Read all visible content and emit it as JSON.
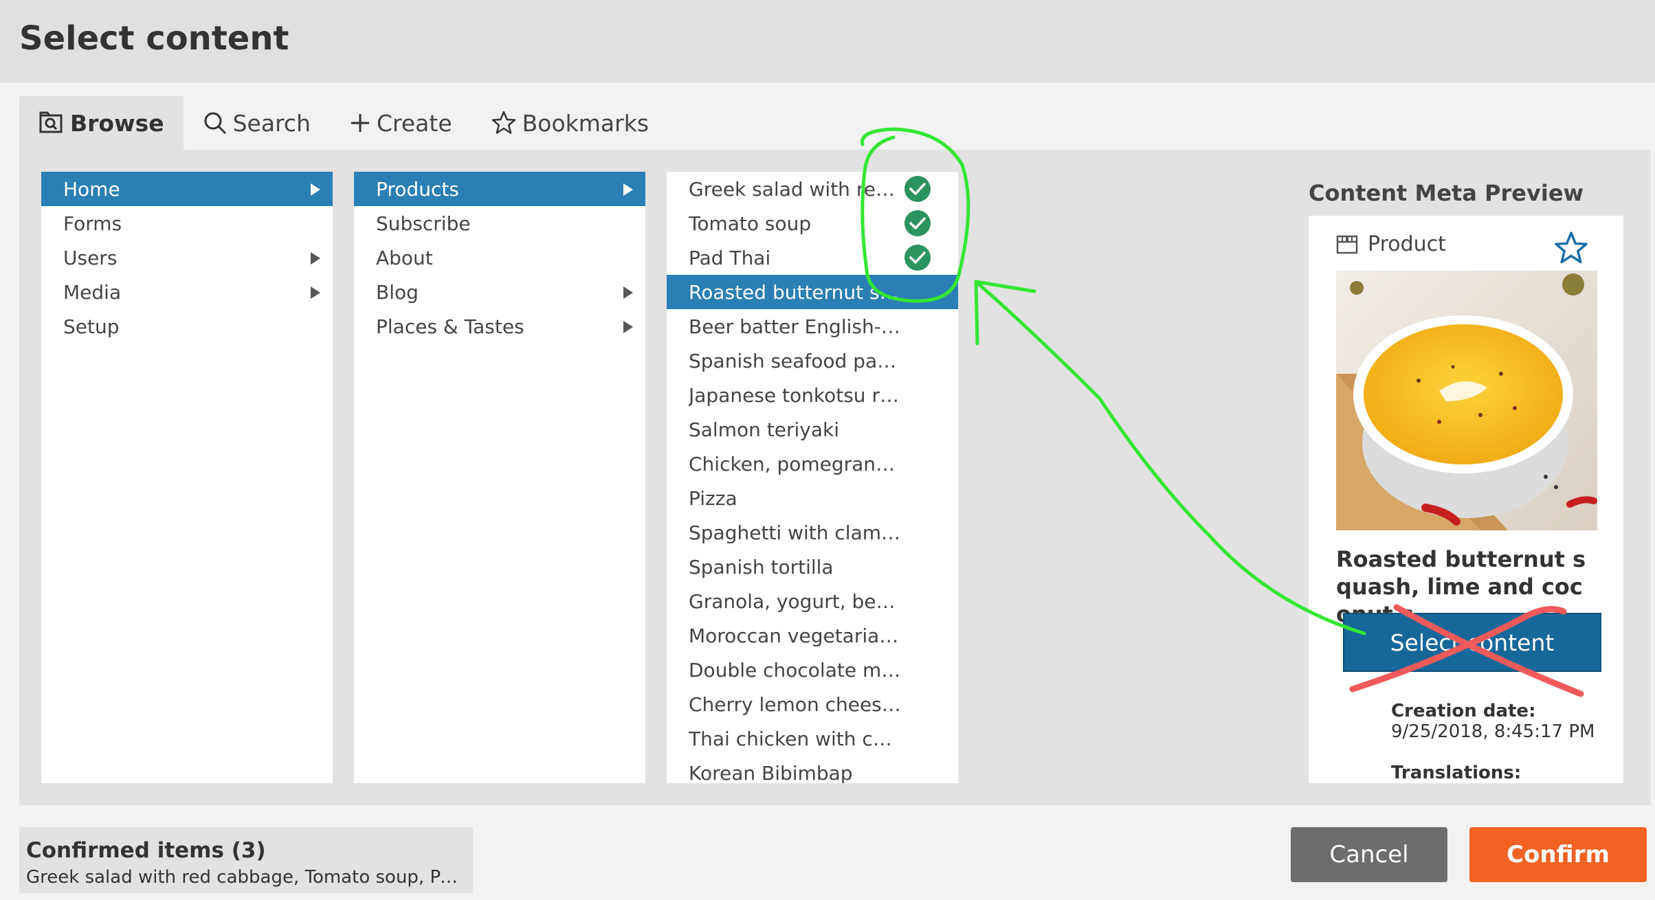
{
  "dialog": {
    "title": "Select content"
  },
  "tabs": [
    {
      "label": "Browse",
      "icon": "browse-icon",
      "active": true
    },
    {
      "label": "Search",
      "icon": "search-icon"
    },
    {
      "label": "Create",
      "icon": "plus-icon"
    },
    {
      "label": "Bookmarks",
      "icon": "star-icon"
    }
  ],
  "columns": {
    "col1": [
      {
        "label": "Home",
        "selected": true,
        "has_children": true
      },
      {
        "label": "Forms"
      },
      {
        "label": "Users",
        "has_children": true
      },
      {
        "label": "Media",
        "has_children": true
      },
      {
        "label": "Setup"
      }
    ],
    "col2": [
      {
        "label": "Products",
        "selected": true,
        "has_children": true
      },
      {
        "label": "Subscribe"
      },
      {
        "label": "About"
      },
      {
        "label": "Blog",
        "has_children": true
      },
      {
        "label": "Places & Tastes",
        "has_children": true
      }
    ],
    "col3": [
      {
        "label": "Greek salad with red ...",
        "checked": true
      },
      {
        "label": "Tomato soup",
        "checked": true
      },
      {
        "label": "Pad Thai",
        "checked": true
      },
      {
        "label": "Roasted butternut sq...",
        "selected": true
      },
      {
        "label": "Beer batter English-st..."
      },
      {
        "label": "Spanish seafood paella"
      },
      {
        "label": "Japanese tonkotsu ra..."
      },
      {
        "label": "Salmon teriyaki"
      },
      {
        "label": "Chicken, pomegranat..."
      },
      {
        "label": "Pizza"
      },
      {
        "label": "Spaghetti with clams ..."
      },
      {
        "label": "Spanish tortilla"
      },
      {
        "label": "Granola, yogurt, berr..."
      },
      {
        "label": "Moroccan vegetarian ..."
      },
      {
        "label": "Double chocolate ma..."
      },
      {
        "label": "Cherry lemon cheese..."
      },
      {
        "label": "Thai chicken with cas..."
      },
      {
        "label": "Korean Bibimbap"
      }
    ]
  },
  "meta_preview": {
    "title": "Content Meta Preview",
    "type_label": "Product",
    "type_icon": "product-icon",
    "bookmark_icon": "star-outline-icon",
    "name": "Roasted butternut squash, lime and coconut s",
    "select_button": "Select content",
    "creation_date_label": "Creation date:",
    "creation_date_value": "9/25/2018, 8:45:17 PM",
    "translations_label": "Translations:"
  },
  "confirmed": {
    "title": "Confirmed items (3)",
    "list": "Greek salad with red cabbage, Tomato soup, Pad T..."
  },
  "buttons": {
    "cancel": "Cancel",
    "confirm": "Confirm"
  },
  "colors": {
    "selected_row": "#2a7fb5",
    "check": "#2a9360",
    "confirm": "#f26222",
    "cancel": "#6d6d6d",
    "annotation_green": "#33e633",
    "annotation_red": "#f05a5a"
  }
}
